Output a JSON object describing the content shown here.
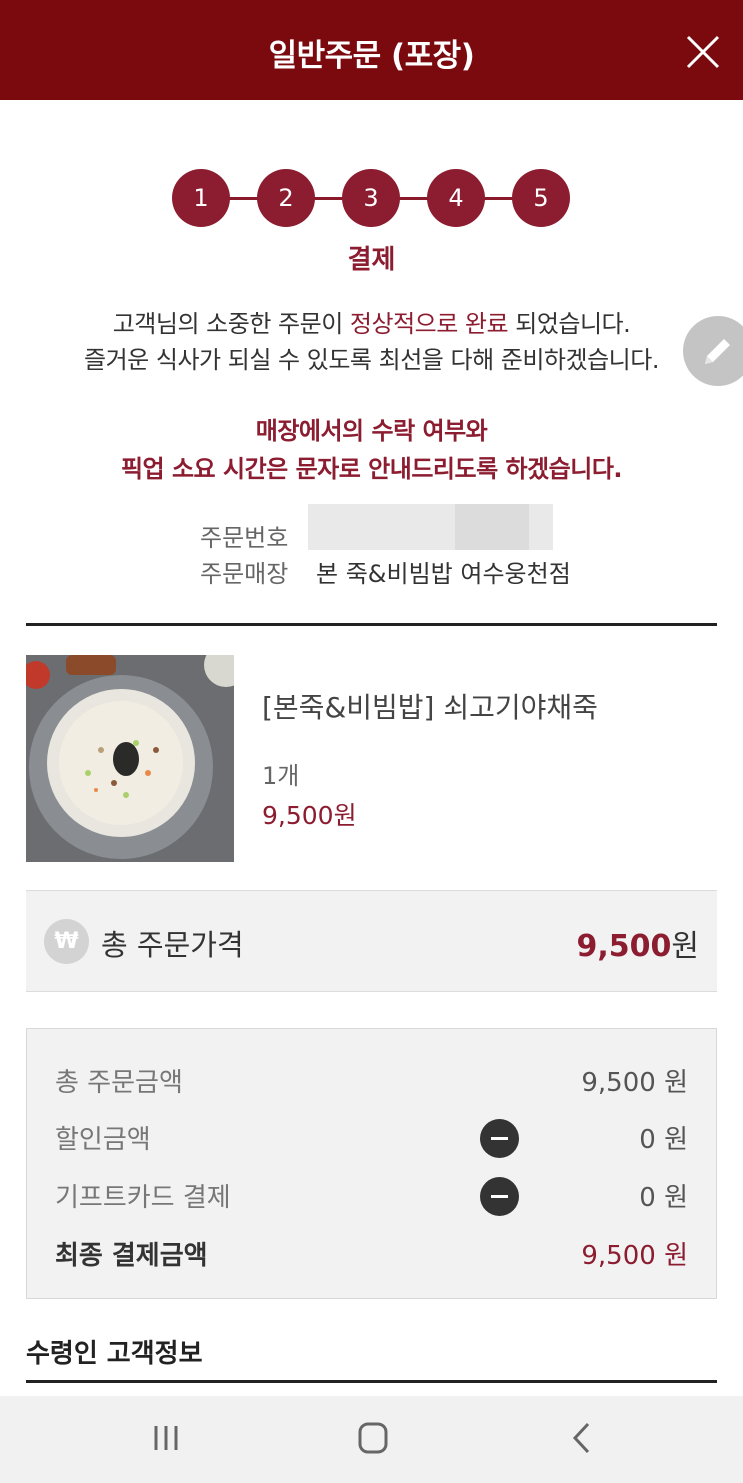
{
  "header": {
    "title": "일반주문 (포장)",
    "close_icon": "close-icon",
    "background": "#7a0a0e"
  },
  "steps": {
    "items": [
      "1",
      "2",
      "3",
      "4",
      "5"
    ],
    "current_label": "결제",
    "accent": "#8c1c30"
  },
  "message": {
    "line1_pre": "고객님의 소중한 주문이 ",
    "line1_highlight": "정상적으로 완료",
    "line1_post": " 되었습니다.",
    "line2": "즐거운 식사가 되실 수 있도록 최선을 다해 준비하겠습니다.",
    "notice_line1": "매장에서의 수락 여부와",
    "notice_line2": "픽업 소요 시간은 문자로 안내드리도록 하겠습니다."
  },
  "order_info": {
    "order_number_label": "주문번호",
    "store_label": "주문매장",
    "store_value": "본 죽&비빔밥 여수웅천점"
  },
  "product": {
    "name": "[본죽&비빔밥] 쇠고기야채죽",
    "quantity": "1개",
    "price": "9,500원"
  },
  "total": {
    "icon": "₩",
    "label": "총 주문가격",
    "amount": "9,500",
    "unit": "원"
  },
  "payment": {
    "rows": [
      {
        "label": "총 주문금액",
        "value": "9,500 원"
      },
      {
        "label": "할인금액",
        "value": "0 원"
      },
      {
        "label": "기프트카드 결제",
        "value": "0 원"
      },
      {
        "label": "최종 결제금액",
        "value": "9,500 원"
      }
    ]
  },
  "receiver_section": {
    "title": "수령인 고객정보"
  },
  "navbar": {
    "recent_icon": "recent-apps-icon",
    "home_icon": "home-icon",
    "back_icon": "back-icon"
  }
}
